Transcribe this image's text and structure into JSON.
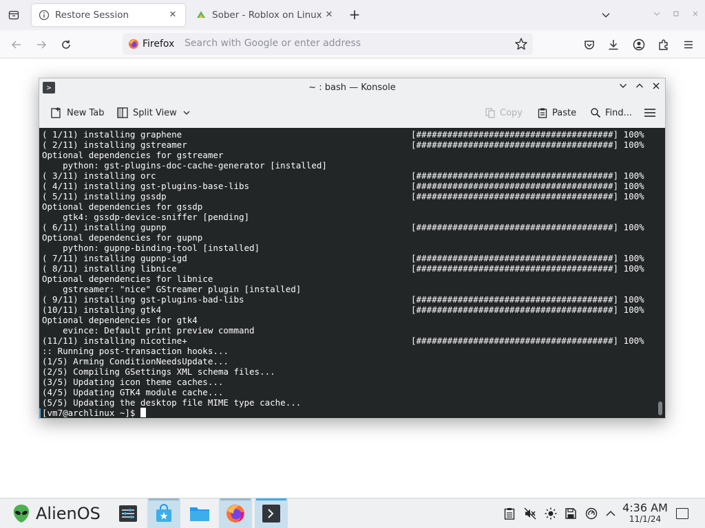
{
  "browser": {
    "tabs": [
      {
        "label": "Restore Session",
        "icon": "info-icon",
        "active": true
      },
      {
        "label": "Sober - Roblox on Linux",
        "icon": "sober-icon",
        "active": false
      }
    ],
    "url_identity": "Firefox",
    "url_placeholder": "Search with Google or enter address",
    "colors": {
      "accent": "#0060df",
      "firefox_orange": "#ff7139"
    }
  },
  "konsole": {
    "title": "~ : bash — Konsole",
    "toolbar": {
      "new_tab": "New Tab",
      "split_view": "Split View",
      "copy": "Copy",
      "paste": "Paste",
      "find": "Find..."
    },
    "terminal": {
      "lines": [
        {
          "text": "( 1/11) installing graphene",
          "bar": "[######################################] 100%"
        },
        {
          "text": "( 2/11) installing gstreamer",
          "bar": "[######################################] 100%"
        },
        {
          "text": "Optional dependencies for gstreamer",
          "bar": ""
        },
        {
          "text": "    python: gst-plugins-doc-cache-generator [installed]",
          "bar": ""
        },
        {
          "text": "( 3/11) installing orc",
          "bar": "[######################################] 100%"
        },
        {
          "text": "( 4/11) installing gst-plugins-base-libs",
          "bar": "[######################################] 100%"
        },
        {
          "text": "( 5/11) installing gssdp",
          "bar": "[######################################] 100%"
        },
        {
          "text": "Optional dependencies for gssdp",
          "bar": ""
        },
        {
          "text": "    gtk4: gssdp-device-sniffer [pending]",
          "bar": ""
        },
        {
          "text": "( 6/11) installing gupnp",
          "bar": "[######################################] 100%"
        },
        {
          "text": "Optional dependencies for gupnp",
          "bar": ""
        },
        {
          "text": "    python: gupnp-binding-tool [installed]",
          "bar": ""
        },
        {
          "text": "( 7/11) installing gupnp-igd",
          "bar": "[######################################] 100%"
        },
        {
          "text": "( 8/11) installing libnice",
          "bar": "[######################################] 100%"
        },
        {
          "text": "Optional dependencies for libnice",
          "bar": ""
        },
        {
          "text": "    gstreamer: \"nice\" GStreamer plugin [installed]",
          "bar": ""
        },
        {
          "text": "( 9/11) installing gst-plugins-bad-libs",
          "bar": "[######################################] 100%"
        },
        {
          "text": "(10/11) installing gtk4",
          "bar": "[######################################] 100%"
        },
        {
          "text": "Optional dependencies for gtk4",
          "bar": ""
        },
        {
          "text": "    evince: Default print preview command",
          "bar": ""
        },
        {
          "text": "(11/11) installing nicotine+",
          "bar": "[######################################] 100%"
        },
        {
          "text": ":: Running post-transaction hooks...",
          "bar": ""
        },
        {
          "text": "(1/5) Arming ConditionNeedsUpdate...",
          "bar": ""
        },
        {
          "text": "(2/5) Compiling GSettings XML schema files...",
          "bar": ""
        },
        {
          "text": "(3/5) Updating icon theme caches...",
          "bar": ""
        },
        {
          "text": "(4/5) Updating GTK4 module cache...",
          "bar": ""
        },
        {
          "text": "(5/5) Updating the desktop file MIME type cache...",
          "bar": ""
        }
      ],
      "prompt": "[vm7@archlinux ~]$ "
    }
  },
  "taskbar": {
    "start_label": "AlienOS",
    "tasks": [
      "system-settings-icon",
      "discover-store-icon",
      "file-manager-icon",
      "firefox-icon",
      "konsole-icon"
    ],
    "tray": [
      "clipboard-icon",
      "volume-muted-icon",
      "brightness-icon",
      "storage-icon",
      "updates-icon",
      "tray-expand-icon"
    ],
    "time": "4:36 AM",
    "date": "11/1/24"
  }
}
